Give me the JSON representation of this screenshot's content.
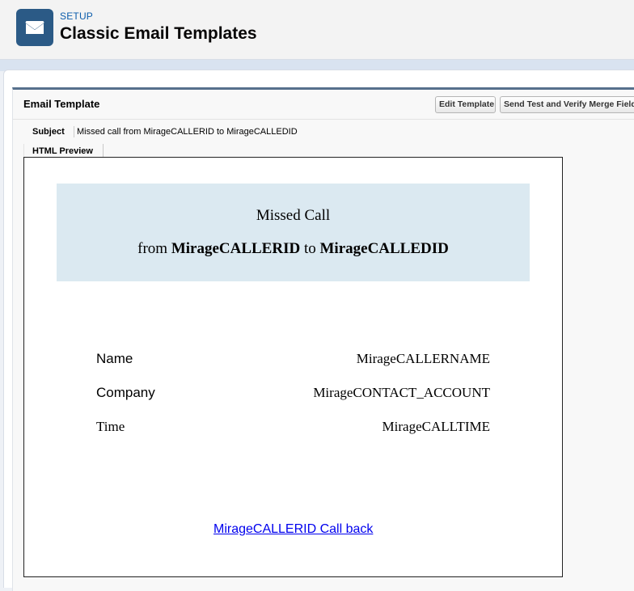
{
  "header": {
    "setup_label": "SETUP",
    "title": "Classic Email Templates",
    "icon": "email-icon"
  },
  "panel": {
    "title": "Email Template",
    "edit_button": "Edit Template",
    "send_button": "Send Test and Verify Merge Fields"
  },
  "subject": {
    "label": "Subject",
    "value": "Missed call from MirageCALLERID to MirageCALLEDID"
  },
  "tab": {
    "label": "HTML Preview"
  },
  "preview": {
    "heading": "Missed Call",
    "from_word": "from",
    "caller_id": "MirageCALLERID",
    "to_word": "to",
    "called_id": "MirageCALLEDID",
    "rows": [
      {
        "label": "Name",
        "value": "MirageCALLERNAME"
      },
      {
        "label": "Company",
        "value": "MirageCONTACT_ACCOUNT"
      },
      {
        "label": "Time",
        "value": "MirageCALLTIME"
      }
    ],
    "callback_link": "MirageCALLERID Call back"
  },
  "colors": {
    "brand_icon_bg": "#2b5a86",
    "banner_bg": "#dbe9f1",
    "link": "#0000ee",
    "panel_border": "#56708c"
  }
}
